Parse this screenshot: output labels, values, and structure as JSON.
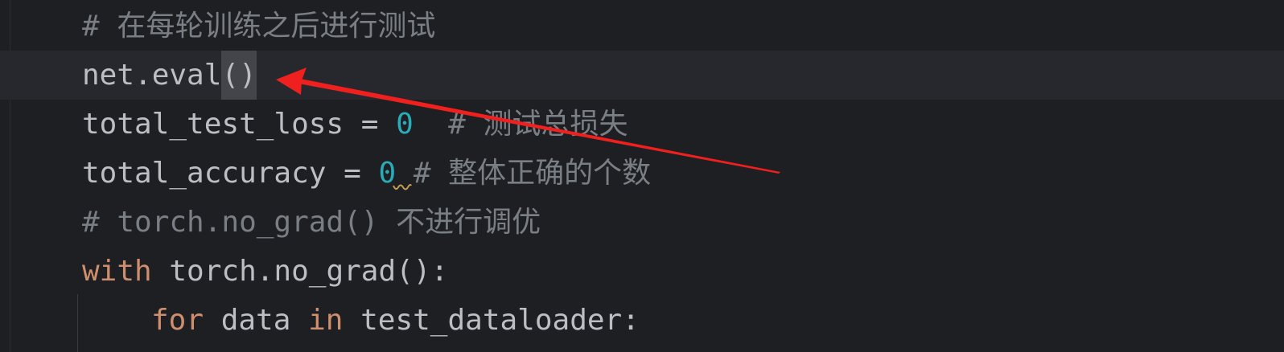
{
  "editor": {
    "lines": {
      "l1": {
        "comment": "# 在每轮训练之后进行测试"
      },
      "l2": {
        "text": "net.eval",
        "paren": "()"
      },
      "l3": {
        "text": "total_test_loss = ",
        "number": "0",
        "comment": "  # 测试总损失"
      },
      "l4": {
        "text": "total_accuracy = ",
        "number": "0",
        "comment": " # 整体正确的个数"
      },
      "l5": {
        "comment": "# torch.no_grad() 不进行调优"
      },
      "l6": {
        "keyword": "with",
        "text": " torch.no_grad():"
      },
      "l7": {
        "keyword1": "for",
        "text1": " data ",
        "keyword2": "in",
        "text2": " test_dataloader:"
      }
    }
  },
  "annotation": {
    "arrow_color": "#f0201e"
  },
  "colors": {
    "background": "#1e1f22",
    "current_line": "#26282e",
    "comment": "#7a7e85",
    "keyword": "#cf8e6d",
    "number": "#2aacb8",
    "text": "#bcbec4"
  }
}
